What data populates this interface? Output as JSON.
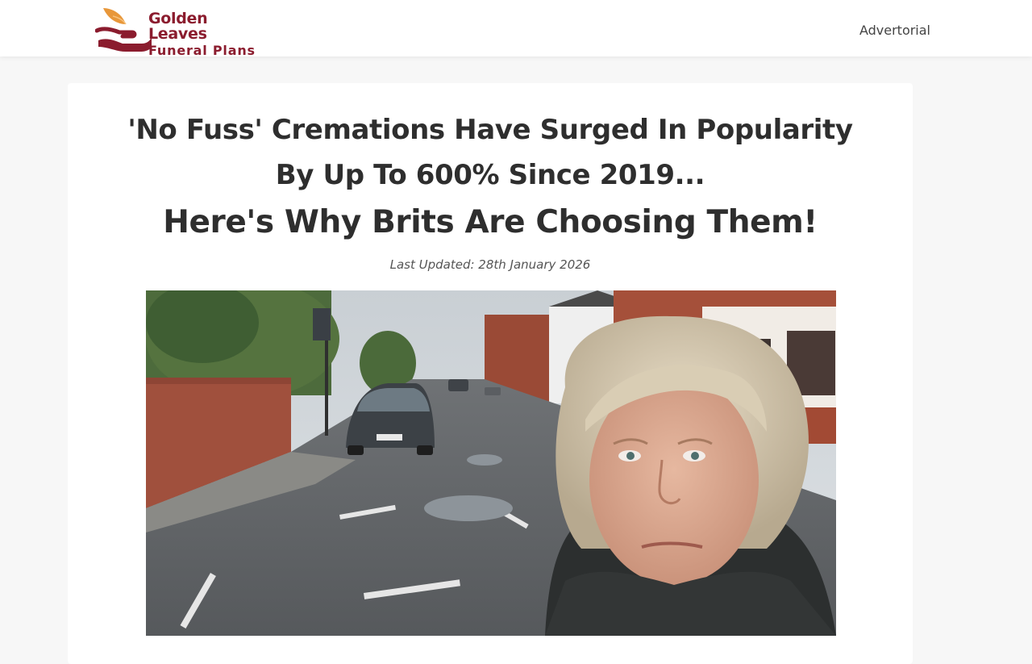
{
  "header": {
    "logo": {
      "line1": "Golden Leaves",
      "line2": "Funeral Plans",
      "icon": "hands-leaf-icon"
    },
    "advertorial_label": "Advertorial"
  },
  "article": {
    "headline": {
      "line1": "'No Fuss' Cremations Have Surged In Popularity",
      "line2": "By Up To 600% Since 2019...",
      "line3": "Here's Why Brits Are Choosing Them!"
    },
    "last_updated": "Last Updated: 28th January 2026",
    "hero_image": {
      "icon": "street-selfie-photo"
    }
  },
  "colors": {
    "brand": "#8b1c2e",
    "leaf": "#e8973a",
    "text": "#2e2e2e",
    "background": "#f7f7f7"
  }
}
